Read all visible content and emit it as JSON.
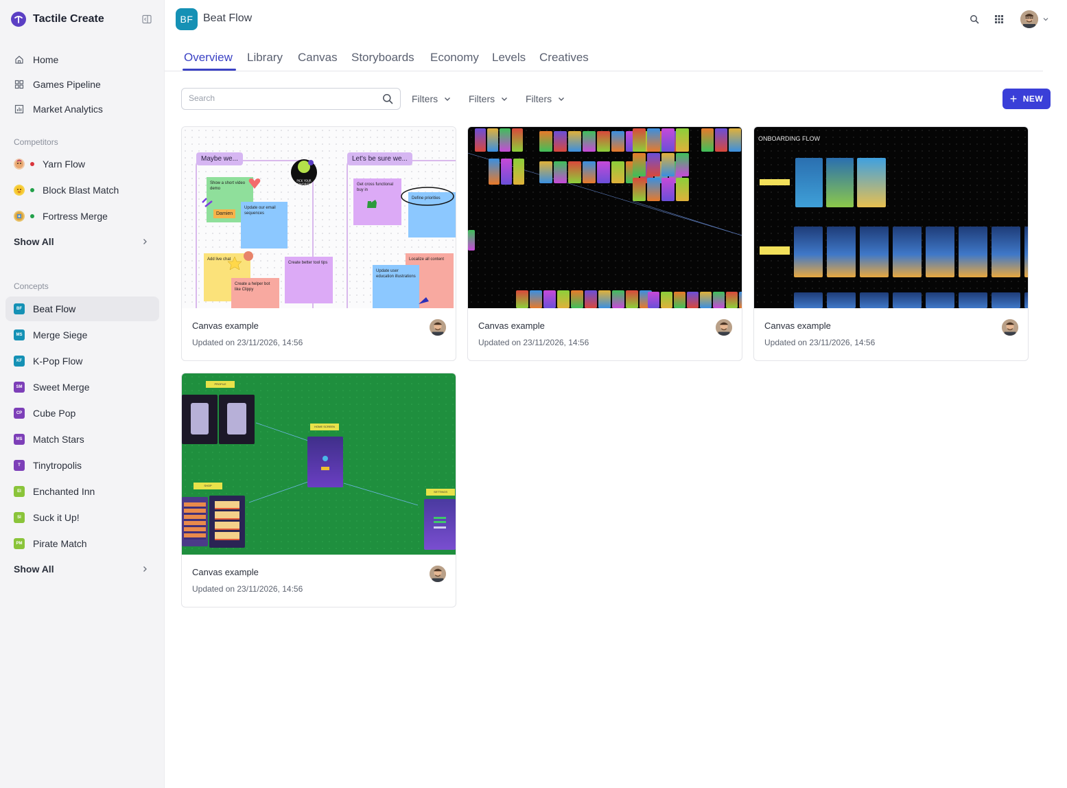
{
  "app": {
    "brand_name": "Tactile Create"
  },
  "sidebar": {
    "nav": [
      {
        "label": "Home",
        "icon": "home-icon"
      },
      {
        "label": "Games Pipeline",
        "icon": "grid-icon"
      },
      {
        "label": "Market Analytics",
        "icon": "chart-icon"
      }
    ],
    "competitors_label": "Competitors",
    "competitors": [
      {
        "label": "Yarn Flow",
        "status_color": "#d9343b"
      },
      {
        "label": "Block Blast Match",
        "status_color": "#22a04a"
      },
      {
        "label": "Fortress Merge",
        "status_color": "#22a04a"
      }
    ],
    "competitors_show_all": "Show All",
    "concepts_label": "Concepts",
    "concepts": [
      {
        "label": "Beat Flow",
        "badge": "BF",
        "color": "#1591b5",
        "active": true
      },
      {
        "label": "Merge Siege",
        "badge": "MS",
        "color": "#1591b5"
      },
      {
        "label": "K-Pop Flow",
        "badge": "KF",
        "color": "#1591b5"
      },
      {
        "label": "Sweet Merge",
        "badge": "SM",
        "color": "#7d3fb8"
      },
      {
        "label": "Cube Pop",
        "badge": "CP",
        "color": "#7d3fb8"
      },
      {
        "label": "Match Stars",
        "badge": "MS",
        "color": "#7d3fb8"
      },
      {
        "label": "Tinytropolis",
        "badge": "T",
        "color": "#7d3fb8"
      },
      {
        "label": "Enchanted Inn",
        "badge": "EI",
        "color": "#8ac43a"
      },
      {
        "label": "Suck it Up!",
        "badge": "SI",
        "color": "#8ac43a"
      },
      {
        "label": "Pirate Match",
        "badge": "PM",
        "color": "#8ac43a"
      }
    ],
    "concepts_show_all": "Show All"
  },
  "header": {
    "project_badge": "BF",
    "project_name": "Beat Flow"
  },
  "tabs": [
    "Overview",
    "Library",
    "Canvas",
    "Storyboards",
    "Economy",
    "Levels",
    "Creatives"
  ],
  "active_tab": "Overview",
  "toolbar": {
    "search_placeholder": "Search",
    "filters": [
      "Filters",
      "Filters",
      "Filters"
    ],
    "new_label": "NEW"
  },
  "cards": [
    {
      "title": "Canvas example",
      "updated": "Updated on 23/11/2026, 14:56"
    },
    {
      "title": "Canvas example",
      "updated": "Updated on 23/11/2026, 14:56"
    },
    {
      "title": "Canvas example",
      "updated": "Updated on 23/11/2026, 14:56"
    },
    {
      "title": "Canvas example",
      "updated": "Updated on 23/11/2026, 14:56"
    }
  ],
  "thumb_whiteboard": {
    "tag_1": "Maybe we...",
    "tag_2": "Let's be sure we...",
    "notes": [
      "Show a short video demo",
      "Update our email sequences",
      "Add live chat",
      "Create a helper bot like Clippy",
      "Create better tool tips",
      "Get cross functional buy in",
      "Define priorities",
      "Localize all content",
      "Update user education illustrations"
    ],
    "sticker": "PICK YOUR FAVORITE",
    "name_tag": "Damien"
  },
  "thumb_onboarding": {
    "title": "ONBOARDING FLOW"
  },
  "thumb_green": {
    "labels": [
      "PROFILE",
      "HOME SCREEN",
      "SHOP",
      "SETTINGS"
    ]
  }
}
